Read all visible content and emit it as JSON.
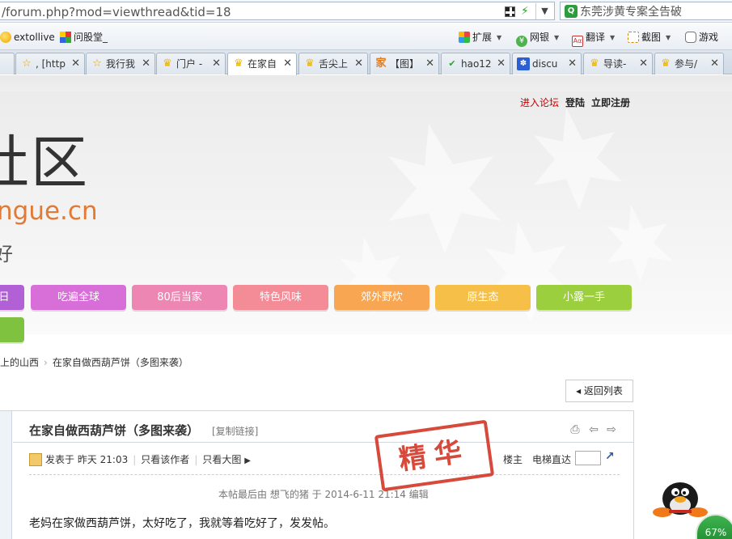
{
  "browser": {
    "url": "/forum.php?mod=viewthread&tid=18",
    "search_placeholder": "东莞涉黄专案全告破",
    "bookmarks": [
      "extollive",
      "问股堂_"
    ],
    "toolbar": [
      "扩展",
      "网银",
      "翻译",
      "截图",
      "游戏"
    ],
    "tabs": [
      {
        "label": "",
        "icon": "star-icon"
      },
      {
        "label": ", [http",
        "icon": "star-icon"
      },
      {
        "label": "我行我",
        "icon": "star-icon"
      },
      {
        "label": "门户 -",
        "icon": "trophy-icon"
      },
      {
        "label": "在家自",
        "icon": "trophy-icon",
        "active": true
      },
      {
        "label": "舌尖上",
        "icon": "trophy-icon"
      },
      {
        "label": "【图】",
        "icon": "home-icon"
      },
      {
        "label": "hao12",
        "icon": "hao123-icon"
      },
      {
        "label": "discu",
        "icon": "paw-icon"
      },
      {
        "label": "导读-",
        "icon": "trophy-icon"
      },
      {
        "label": "参与/",
        "icon": "trophy-icon"
      }
    ]
  },
  "header": {
    "login_links": {
      "forum": "进入论坛",
      "login": "登陆",
      "register": "立即注册"
    },
    "site_title": "社区",
    "site_domain": "ngue.cn",
    "site_slogan": "好"
  },
  "nav": {
    "items": [
      {
        "label": "日",
        "color": "#b260d6"
      },
      {
        "label": "吃遍全球",
        "color": "#d86fd8"
      },
      {
        "label": "80后当家",
        "color": "#ee86b3"
      },
      {
        "label": "特色风味",
        "color": "#f48c98"
      },
      {
        "label": "郊外野炊",
        "color": "#f9a652"
      },
      {
        "label": "原生态",
        "color": "#f6bf48"
      },
      {
        "label": "小露一手",
        "color": "#9ccf3e"
      },
      {
        "label": "",
        "color": "#7fc23f"
      }
    ]
  },
  "breadcrumb": {
    "parent": "上的山西",
    "current": "在家自做西葫芦饼（多图来袭）"
  },
  "back_to_list": "返回列表",
  "post": {
    "title": "在家自做西葫芦饼（多图来袭）",
    "copy_link": "[复制链接]",
    "posted_label": "发表于",
    "posted_time": "昨天 21:03",
    "only_author": "只看该作者",
    "only_large": "只看大图",
    "floor": "楼主",
    "jump_label": "电梯直达",
    "edit_note": "本帖最后由 想飞的猪 于 2014-6-11 21:14 编辑",
    "body": "老妈在家做西葫芦饼，太好吃了，我就等着吃好了，发发帖。",
    "stamp": "精华"
  },
  "speed_gauge": "67%"
}
